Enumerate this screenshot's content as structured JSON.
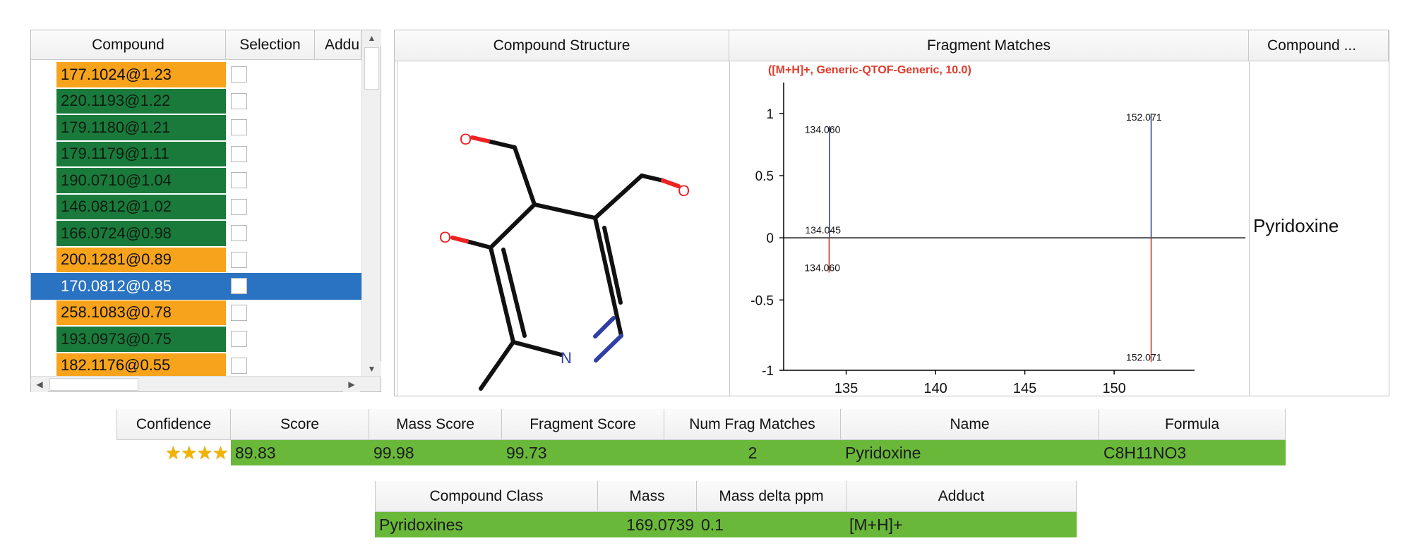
{
  "compound_list": {
    "columns": [
      "Compound",
      "Selection",
      "Addu"
    ],
    "rows": [
      {
        "label": "177.1024@1.23",
        "status": "orange"
      },
      {
        "label": "220.1193@1.22",
        "status": "green"
      },
      {
        "label": "179.1180@1.21",
        "status": "green"
      },
      {
        "label": "179.1179@1.11",
        "status": "green"
      },
      {
        "label": "190.0710@1.04",
        "status": "green"
      },
      {
        "label": "146.0812@1.02",
        "status": "green"
      },
      {
        "label": "166.0724@0.98",
        "status": "green"
      },
      {
        "label": "200.1281@0.89",
        "status": "orange"
      },
      {
        "label": "170.0812@0.85",
        "status": "selected"
      },
      {
        "label": "258.1083@0.78",
        "status": "orange"
      },
      {
        "label": "193.0973@0.75",
        "status": "green"
      },
      {
        "label": "182.1176@0.55",
        "status": "orange"
      }
    ]
  },
  "detail_panel": {
    "columns": [
      "Compound Structure",
      "Fragment Matches",
      "Compound ..."
    ],
    "structure_atoms": {
      "o1": "O",
      "o2": "O",
      "o3": "O",
      "n": "N"
    },
    "side_label": "Pyridoxine"
  },
  "chart_data": {
    "type": "bar",
    "title": "([M+H]+, Generic-QTOF-Generic, 10.0)",
    "xlim": [
      131.5,
      154.5
    ],
    "ylim": [
      -1.1,
      1.25
    ],
    "x_ticks": [
      "135",
      "140",
      "145",
      "150"
    ],
    "y_ticks": [
      "1",
      "0.5",
      "0",
      "-0.5",
      "-1"
    ],
    "series": [
      {
        "name": "",
        "color": "#3a4a8a",
        "points": [
          {
            "x": 134.06,
            "y": 0.9,
            "label": "134.060"
          },
          {
            "x": 152.071,
            "y": 1.0,
            "label": "152.071"
          }
        ]
      },
      {
        "name": "",
        "color": "#c0392b",
        "points": [
          {
            "x": 134.045,
            "y": -0.28,
            "label": "134.060"
          },
          {
            "x": 152.071,
            "y": -1.0,
            "label": "152.071"
          }
        ]
      }
    ],
    "zero_labels": [
      "134.045"
    ]
  },
  "score_table": {
    "columns": [
      "Confidence",
      "Score",
      "Mass Score",
      "Fragment Score",
      "Num Frag Matches",
      "Name",
      "Formula"
    ],
    "row": {
      "stars": "★★★★",
      "score": "89.83",
      "mass_score": "99.98",
      "fragment_score": "99.73",
      "num_frag": "2",
      "name": "Pyridoxine",
      "formula": "C8H11NO3"
    }
  },
  "class_table": {
    "columns": [
      "Compound Class",
      "Mass",
      "Mass delta ppm",
      "Adduct"
    ],
    "row": {
      "compound_class": "Pyridoxines",
      "mass": "169.0739",
      "delta_ppm": "0.1",
      "adduct": "[M+H]+"
    }
  },
  "colors": {
    "green": "#1a7a3c",
    "orange": "#f7a31c",
    "selected": "#2a73c2",
    "score_row": "#6ab83a"
  }
}
